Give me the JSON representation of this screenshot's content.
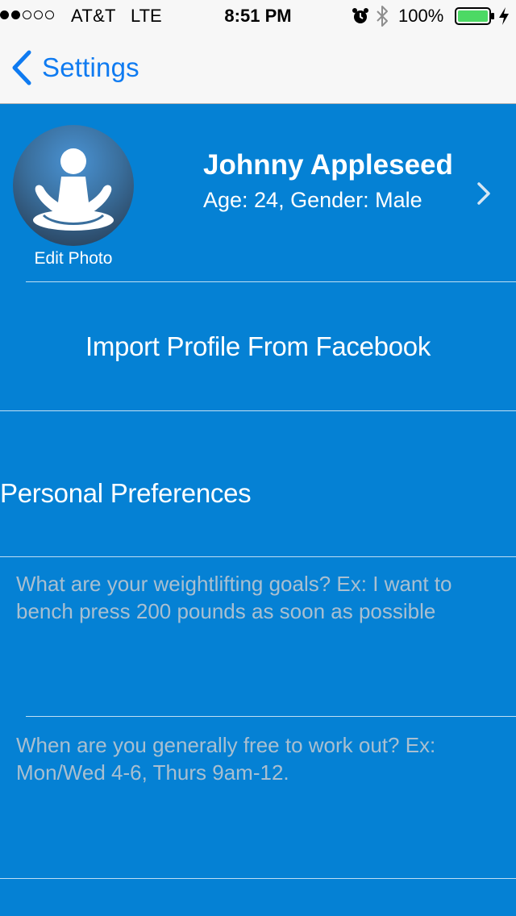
{
  "status_bar": {
    "signal_strength": 2,
    "signal_total": 5,
    "carrier": "AT&T",
    "network": "LTE",
    "time": "8:51 PM",
    "battery_percent": "100%",
    "icons": [
      "alarm-icon",
      "bluetooth-icon",
      "battery-icon",
      "charging-icon"
    ]
  },
  "nav": {
    "back_label": "Settings"
  },
  "profile": {
    "name": "Johnny Appleseed",
    "details": "Age: 24, Gender: Male",
    "edit_photo_label": "Edit Photo",
    "avatar_icon": "meditating-person-icon"
  },
  "import_label": "Import Profile From Facebook",
  "preferences": {
    "heading": "Personal Preferences",
    "goals_placeholder": "What are your weightlifting goals? Ex: I want to bench press 200 pounds as soon as possible",
    "availability_placeholder": "When are you generally free to work out? Ex: Mon/Wed 4-6, Thurs 9am-12."
  },
  "colors": {
    "background": "#0581d4",
    "nav_background": "#f7f7f7",
    "nav_tint": "#0f7bf1",
    "placeholder": "#a9bfd0",
    "battery_fill": "#4cd964"
  }
}
